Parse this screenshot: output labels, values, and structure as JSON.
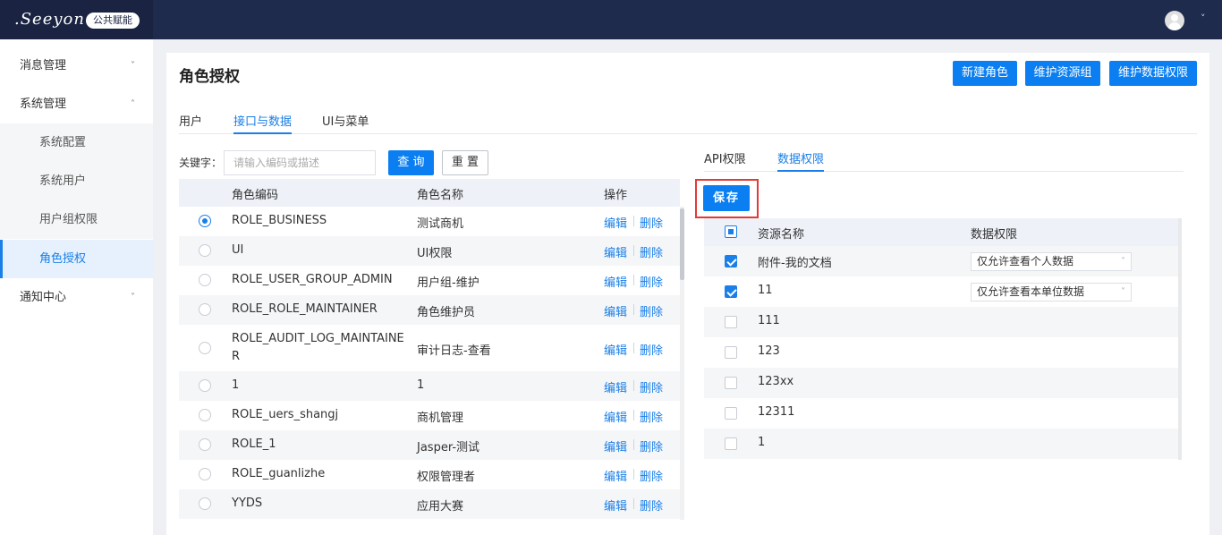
{
  "header": {
    "logo_text": ".Seeyon",
    "badge": "公共赋能",
    "avatar_icon": "user-avatar-icon",
    "user_menu_icon": "chevron-down-icon"
  },
  "sidebar": {
    "items": [
      {
        "label": "消息管理",
        "chevron": "˅"
      },
      {
        "label": "系统管理",
        "chevron": "˄"
      },
      {
        "label": "通知中心",
        "chevron": "˅"
      }
    ],
    "subitems": [
      {
        "label": "系统配置"
      },
      {
        "label": "系统用户"
      },
      {
        "label": "用户组权限"
      },
      {
        "label": "角色授权"
      }
    ]
  },
  "page": {
    "title": "角色授权",
    "buttons": {
      "new_role": "新建角色",
      "maintain_group": "维护资源组",
      "maintain_data": "维护数据权限"
    },
    "tabs": [
      "用户",
      "接口与数据",
      "UI与菜单"
    ]
  },
  "filter": {
    "label": "关键字：",
    "placeholder": "请输入编码或描述",
    "query": "查 询",
    "reset": "重 置"
  },
  "role_table": {
    "headers": {
      "code": "角色编码",
      "name": "角色名称",
      "ops": "操作"
    },
    "edit": "编辑",
    "delete": "删除",
    "rows": [
      {
        "code": "ROLE_BUSINESS",
        "name": "测试商机",
        "selected": true
      },
      {
        "code": "UI",
        "name": "UI权限",
        "selected": false
      },
      {
        "code": "ROLE_USER_GROUP_ADMIN",
        "name": "用户组-维护",
        "selected": false
      },
      {
        "code": "ROLE_ROLE_MAINTAINER",
        "name": "角色维护员",
        "selected": false
      },
      {
        "code": "ROLE_AUDIT_LOG_MAINTAINE",
        "code2": "R",
        "name": "审计日志-查看",
        "selected": false
      },
      {
        "code": "1",
        "name": "1",
        "selected": false
      },
      {
        "code": "ROLE_uers_shangj",
        "name": "商机管理",
        "selected": false
      },
      {
        "code": "ROLE_1",
        "name": "Jasper-测试",
        "selected": false
      },
      {
        "code": "ROLE_guanlizhe",
        "name": "权限管理者",
        "selected": false
      },
      {
        "code": "YYDS",
        "name": "应用大赛",
        "selected": false
      }
    ]
  },
  "right": {
    "tabs": [
      "API权限",
      "数据权限"
    ],
    "save": "保存",
    "headers": {
      "resource": "资源名称",
      "perm": "数据权限"
    },
    "rows": [
      {
        "name": "附件-我的文档",
        "checked": true,
        "perm": "仅允许查看个人数据"
      },
      {
        "name": "11",
        "checked": true,
        "perm": "仅允许查看本单位数据"
      },
      {
        "name": "111",
        "checked": false,
        "perm": ""
      },
      {
        "name": "123",
        "checked": false,
        "perm": ""
      },
      {
        "name": "123xx",
        "checked": false,
        "perm": ""
      },
      {
        "name": "12311",
        "checked": false,
        "perm": ""
      },
      {
        "name": "1",
        "checked": false,
        "perm": ""
      }
    ]
  },
  "colors": {
    "primary": "#0b7ff2",
    "nav": "#1f2b4d",
    "highlight": "#e33a36"
  }
}
